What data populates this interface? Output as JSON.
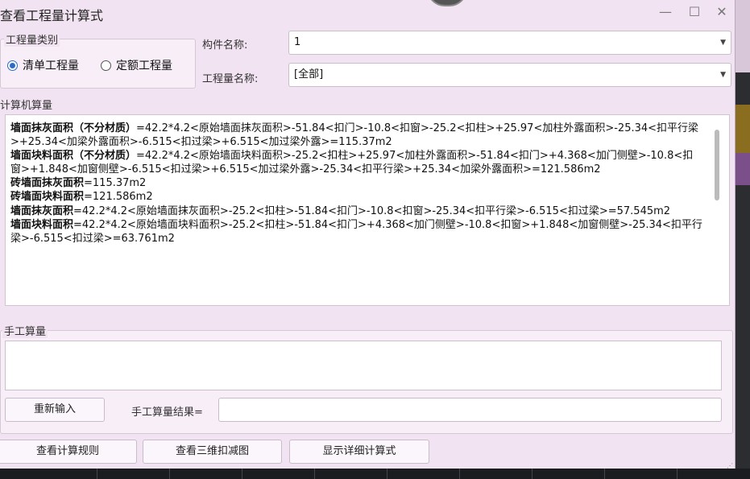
{
  "window": {
    "title": "查看工程量计算式",
    "minimize": "—",
    "maximize": "☐",
    "close": "✕"
  },
  "category": {
    "group_label": "工程量类别",
    "options": [
      {
        "label": "清单工程量",
        "selected": true
      },
      {
        "label": "定额工程量",
        "selected": false
      }
    ]
  },
  "component": {
    "label": "构件名称:",
    "value": "1"
  },
  "quantity_name": {
    "label": "工程量名称:",
    "value": "[全部]"
  },
  "computer_calc": {
    "group_label": "计算机算量",
    "lines": [
      {
        "name": "墙面抹灰面积（不分材质）",
        "formula": "=42.2*4.2<原始墙面抹灰面积>-51.84<扣门>-10.8<扣窗>-25.2<扣柱>+25.97<加柱外露面积>-25.34<扣平行梁>+25.34<加梁外露面积>-6.515<扣过梁>+6.515<加过梁外露>=115.37m2"
      },
      {
        "name": "墙面块料面积（不分材质）",
        "formula": "=42.2*4.2<原始墙面块料面积>-25.2<扣柱>+25.97<加柱外露面积>-51.84<扣门>+4.368<加门侧壁>-10.8<扣窗>+1.848<加窗侧壁>-6.515<扣过梁>+6.515<加过梁外露>-25.34<扣平行梁>+25.34<加梁外露面积>=121.586m2"
      },
      {
        "name": "砖墙面抹灰面积",
        "formula": "=115.37m2"
      },
      {
        "name": "砖墙面块料面积",
        "formula": "=121.586m2"
      },
      {
        "name": "墙面抹灰面积",
        "formula": "=42.2*4.2<原始墙面抹灰面积>-25.2<扣柱>-51.84<扣门>-10.8<扣窗>-25.34<扣平行梁>-6.515<扣过梁>=57.545m2"
      },
      {
        "name": "墙面块料面积",
        "formula": "=42.2*4.2<原始墙面块料面积>-25.2<扣柱>-51.84<扣门>+4.368<加门侧壁>-10.8<扣窗>+1.848<加窗侧壁>-25.34<扣平行梁>-6.515<扣过梁>=63.761m2"
      }
    ]
  },
  "manual_calc": {
    "group_label": "手工算量",
    "text": "",
    "reenter_button": "重新输入",
    "result_label": "手工算量结果=",
    "result_value": ""
  },
  "footer": {
    "view_rules": "查看计算规则",
    "view_3d": "查看三维扣减图",
    "show_detail": "显示详细计算式"
  },
  "colors": {
    "window_bg": "#f1e3f1",
    "accent": "#2a6cc7"
  }
}
